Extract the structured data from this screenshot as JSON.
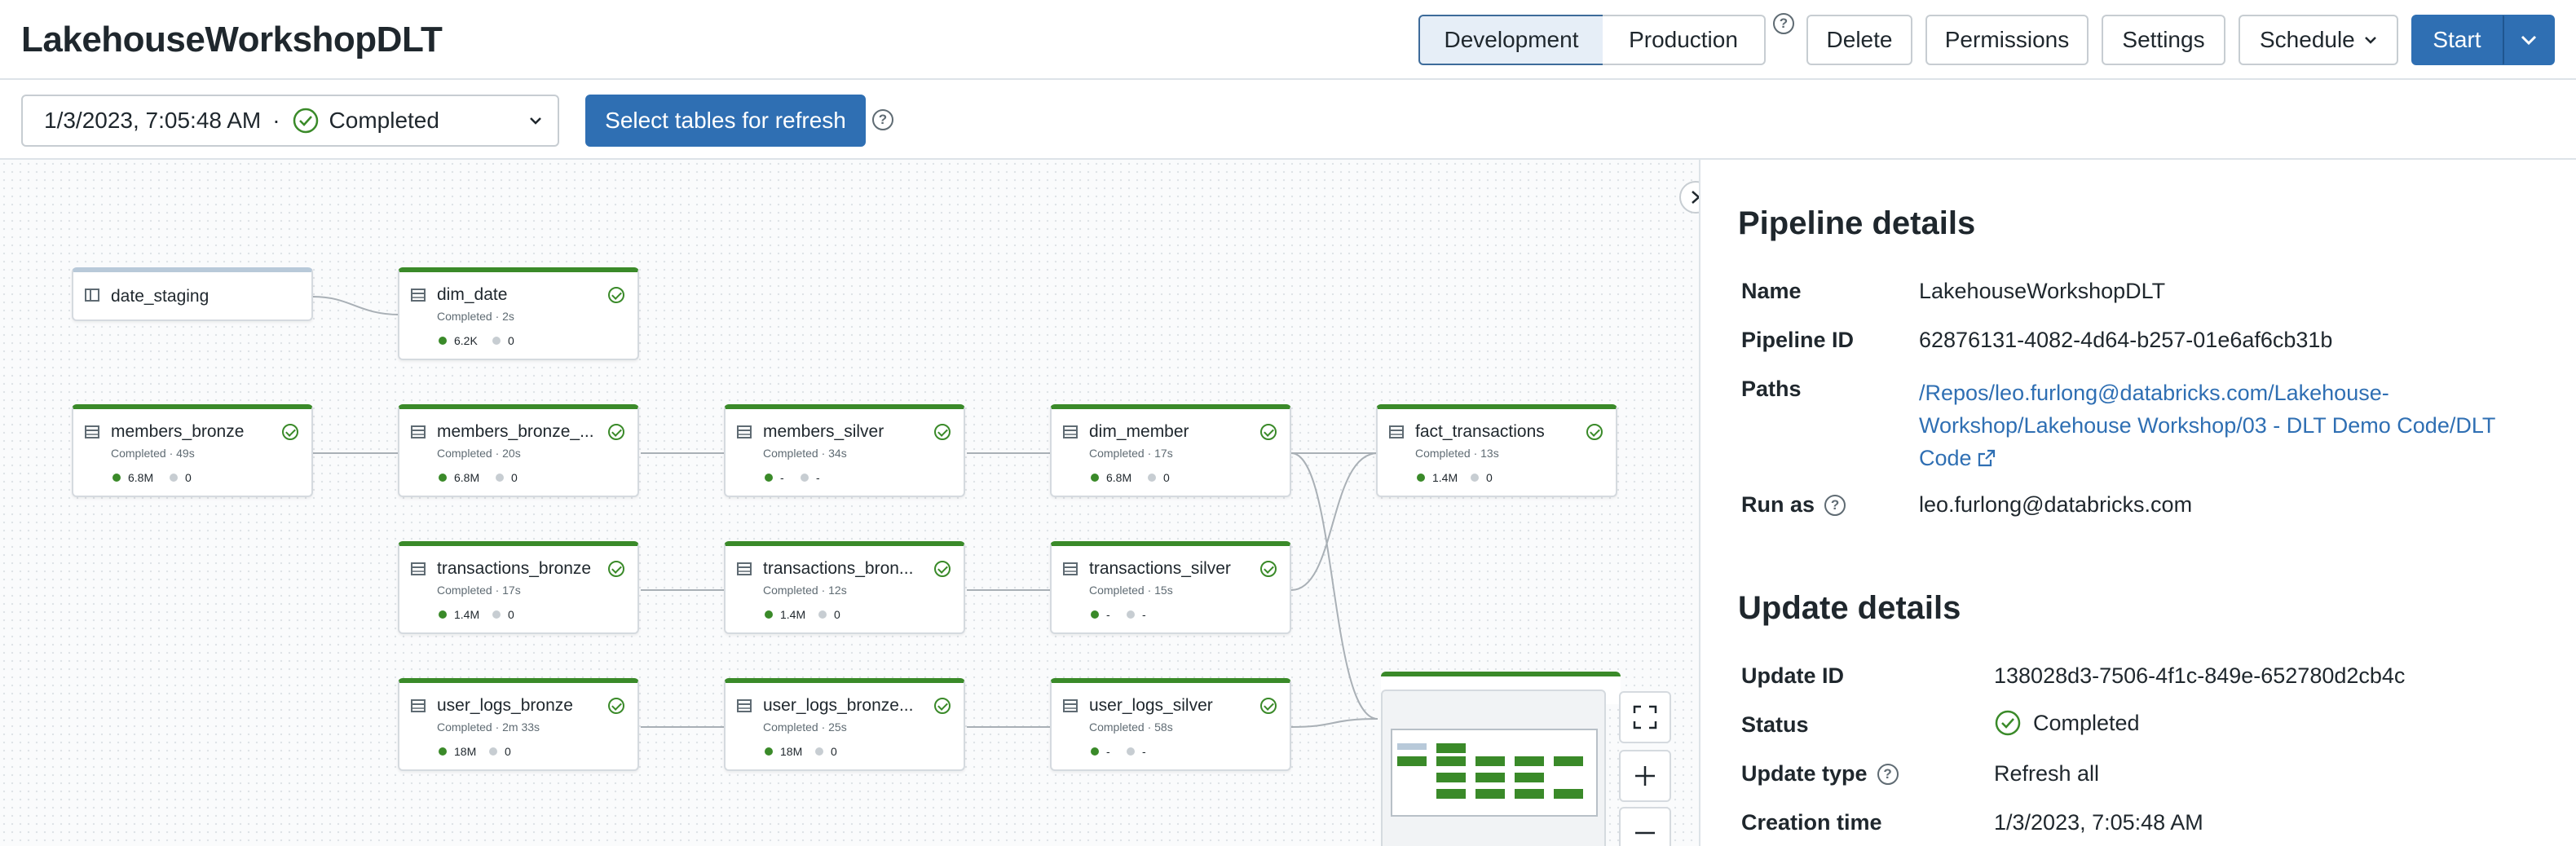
{
  "header": {
    "title": "LakehouseWorkshopDLT",
    "development": "Development",
    "production": "Production",
    "delete": "Delete",
    "permissions": "Permissions",
    "settings": "Settings",
    "schedule": "Schedule",
    "start": "Start"
  },
  "toolbar": {
    "update_time": "1/3/2023, 7:05:48 AM",
    "separator": "·",
    "update_status": "Completed",
    "select_tables": "Select tables for refresh"
  },
  "graph": {
    "nodes": [
      {
        "name": "date_staging",
        "kind": "view"
      },
      {
        "name": "dim_date",
        "status": "Completed · 2s",
        "m1": "6.2K",
        "m2": "0"
      },
      {
        "name": "members_bronze",
        "status": "Completed · 49s",
        "m1": "6.8M",
        "m2": "0"
      },
      {
        "name": "members_bronze_...",
        "status": "Completed · 20s",
        "m1": "6.8M",
        "m2": "0"
      },
      {
        "name": "members_silver",
        "status": "Completed · 34s",
        "m1": "-",
        "m2": "-"
      },
      {
        "name": "dim_member",
        "status": "Completed · 17s",
        "m1": "6.8M",
        "m2": "0"
      },
      {
        "name": "fact_transactions",
        "status": "Completed · 13s",
        "m1": "1.4M",
        "m2": "0"
      },
      {
        "name": "transactions_bronze",
        "status": "Completed · 17s",
        "m1": "1.4M",
        "m2": "0"
      },
      {
        "name": "transactions_bron...",
        "status": "Completed · 12s",
        "m1": "1.4M",
        "m2": "0"
      },
      {
        "name": "transactions_silver",
        "status": "Completed · 15s",
        "m1": "-",
        "m2": "-"
      },
      {
        "name": "user_logs_bronze",
        "status": "Completed · 2m 33s",
        "m1": "18M",
        "m2": "0"
      },
      {
        "name": "user_logs_bronze...",
        "status": "Completed · 25s",
        "m1": "18M",
        "m2": "0"
      },
      {
        "name": "user_logs_silver",
        "status": "Completed · 58s",
        "m1": "-",
        "m2": "-"
      }
    ]
  },
  "pipeline_details": {
    "heading": "Pipeline details",
    "name_label": "Name",
    "name": "LakehouseWorkshopDLT",
    "id_label": "Pipeline ID",
    "id": "62876131-4082-4d64-b257-01e6af6cb31b",
    "paths_label": "Paths",
    "path_line1": "/Repos/leo.furlong@databricks.com/Lakehouse-",
    "path_line2": "Workshop/Lakehouse Workshop/03 - DLT Demo Code/DLT",
    "path_line3": "Code",
    "run_as_label": "Run as",
    "run_as": "leo.furlong@databricks.com"
  },
  "update_details": {
    "heading": "Update details",
    "id_label": "Update ID",
    "id": "138028d3-7506-4f1c-849e-652780d2cb4c",
    "status_label": "Status",
    "status": "Completed",
    "type_label": "Update type",
    "type": "Refresh all",
    "creation_label": "Creation time",
    "creation": "1/3/2023, 7:05:48 AM"
  },
  "colors": {
    "primary": "#2f6fb3",
    "success": "#3a8a29",
    "link": "#2f6fb3",
    "node_top": "#3a8a29"
  }
}
